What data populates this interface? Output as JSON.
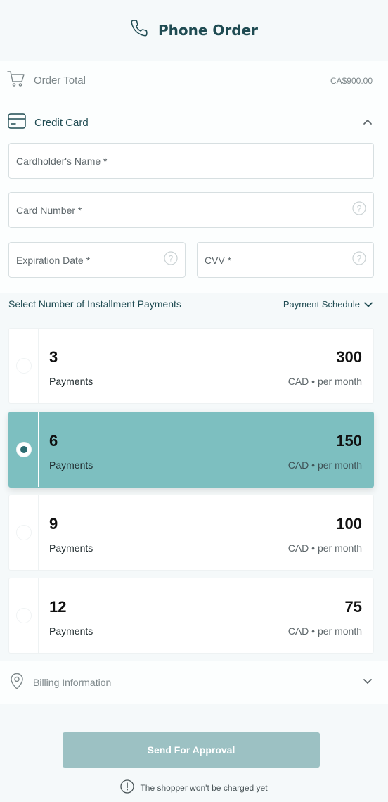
{
  "header": {
    "title": "Phone Order",
    "icon": "phone-icon"
  },
  "order_total": {
    "label": "Order Total",
    "amount": "CA$900.00",
    "icon": "cart-icon"
  },
  "credit_card": {
    "label": "Credit Card",
    "icon": "credit-card-icon",
    "cardholder_placeholder": "Cardholder's Name *",
    "card_number_placeholder": "Card Number *",
    "expiration_placeholder": "Expiration Date *",
    "cvv_placeholder": "CVV *"
  },
  "installments": {
    "heading": "Select Number of Installment Payments",
    "schedule_label": "Payment Schedule",
    "selected_index": 1,
    "options": [
      {
        "count": "3",
        "count_label": "Payments",
        "amount": "300",
        "per": "CAD • per month"
      },
      {
        "count": "6",
        "count_label": "Payments",
        "amount": "150",
        "per": "CAD • per month"
      },
      {
        "count": "9",
        "count_label": "Payments",
        "amount": "100",
        "per": "CAD • per month"
      },
      {
        "count": "12",
        "count_label": "Payments",
        "amount": "75",
        "per": "CAD • per month"
      }
    ]
  },
  "billing": {
    "label": "Billing Information",
    "icon": "location-pin-icon"
  },
  "actions": {
    "send_label": "Send For Approval"
  },
  "note": {
    "text": "The shopper won't be charged yet",
    "icon": "info-icon"
  },
  "colors": {
    "accent": "#7dbfc0",
    "brand_text": "#1f4b52",
    "button": "#9cc1c3"
  }
}
